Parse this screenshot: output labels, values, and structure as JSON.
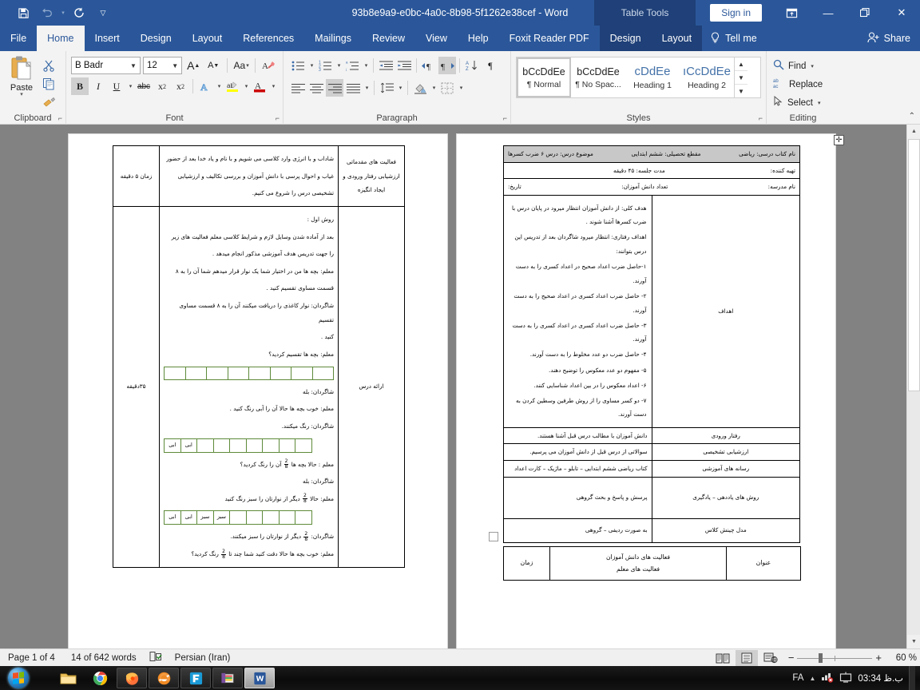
{
  "window": {
    "title": "93b8e9a9-e0bc-4a0c-8b98-5f1262e38cef  -  Word",
    "contextual_tool": "Table Tools",
    "signin_label": "Sign in",
    "minimize": "—",
    "restore": "❐",
    "close": "✕",
    "ribbon_display_options": "ribbon-display-icon"
  },
  "quick_access": {
    "save": "save-icon",
    "undo": "undo-icon",
    "redo": "redo-icon",
    "customize": "customize-icon"
  },
  "tabs": [
    {
      "label": "File",
      "active": false
    },
    {
      "label": "Home",
      "active": true
    },
    {
      "label": "Insert",
      "active": false
    },
    {
      "label": "Design",
      "active": false
    },
    {
      "label": "Layout",
      "active": false
    },
    {
      "label": "References",
      "active": false
    },
    {
      "label": "Mailings",
      "active": false
    },
    {
      "label": "Review",
      "active": false
    },
    {
      "label": "View",
      "active": false
    },
    {
      "label": "Help",
      "active": false
    },
    {
      "label": "Foxit Reader PDF",
      "active": false
    }
  ],
  "table_tools_tabs": [
    {
      "label": "Design"
    },
    {
      "label": "Layout"
    }
  ],
  "tell_me": "Tell me",
  "share": "Share",
  "ribbon": {
    "clipboard": {
      "group_label": "Clipboard",
      "paste_label": "Paste",
      "cut_label": "Cut",
      "copy_label": "Copy",
      "format_painter_label": "Format Painter"
    },
    "font": {
      "group_label": "Font",
      "font_name": "B Badr",
      "font_size": "12",
      "grow_font": "A",
      "shrink_font": "A",
      "change_case": "Aa",
      "clear_formatting": "clear-formatting-icon",
      "bold": "B",
      "italic": "I",
      "underline": "U",
      "strikethrough": "abc",
      "subscript": "x₂",
      "superscript": "x²",
      "text_effects": "A",
      "text_highlight": "ab",
      "font_color": "A"
    },
    "paragraph": {
      "group_label": "Paragraph",
      "bullets": "bullets-icon",
      "numbering": "numbering-icon",
      "multilevel": "multilevel-list-icon",
      "decrease_indent": "decrease-indent-icon",
      "increase_indent": "increase-indent-icon",
      "ltr": "left-to-right-icon",
      "rtl": "right-to-left-icon",
      "sort": "sort-icon",
      "show_marks": "¶",
      "align_left": "align-left-icon",
      "align_center": "align-center-icon",
      "align_right": "align-right-icon",
      "justify": "justify-icon",
      "line_spacing": "line-spacing-icon",
      "shading": "shading-icon",
      "borders": "borders-icon"
    },
    "styles": {
      "group_label": "Styles",
      "items": [
        {
          "sample": "bCcDdEe",
          "name": "¶ Normal",
          "selected": true
        },
        {
          "sample": "bCcDdEe",
          "name": "¶ No Spac...",
          "selected": false
        },
        {
          "sample": "cDdEe",
          "name": "Heading 1",
          "selected": false
        },
        {
          "sample": "ıCcDdEe",
          "name": "Heading 2",
          "selected": false
        }
      ]
    },
    "editing": {
      "group_label": "Editing",
      "find": "Find",
      "replace": "Replace",
      "select": "Select"
    }
  },
  "document": {
    "right_page": {
      "header_table": {
        "row1": {
          "subject": "موضوع درس: درس ۶ ضرب کسرها",
          "grade": "مقطع تحصیلی: ششم ابتدایی",
          "book": "نام کتاب درسی: ریاضی"
        },
        "row2": {
          "duration": "مدت جلسه: ۴۵ دقیقه",
          "author": "تهیه کننده:"
        },
        "row3": {
          "date": "تاریخ:",
          "students": "تعداد دانش آموزان:",
          "school": "نام مدرسه:"
        }
      },
      "rows": [
        {
          "label": "اهداف",
          "lines": [
            "هدف کلی: از دانش آموزان انتظار میرود در پایان درس با ضرب کسرها آشنا شوند .",
            "اهداف رفتاری: انتظار میرود شاگردان بعد از تدریس این درس بتوانند:",
            "۱-حاصل ضرب اعداد صحیح در اعداد کسری را به دست آورند.",
            "۲- حاصل ضرب اعداد کسری در اعداد صحیح را به دست آورند.",
            "۳- حاصل ضرب اعداد کسری در اعداد کسری را به دست آورند.",
            "۴- حاصل ضرب دو عدد مخلوط را به دست آورند.",
            "۵- مفهوم دو عدد معکوس را توضیح دهند.",
            "۶- اعداد معکوس را در بین اعداد شناسایی کنند.",
            "۷- دو کسر مساوی را از روش طرفین وسطین کردن به دست آورند."
          ]
        },
        {
          "label": "رفتار ورودی",
          "lines": [
            "دانش آموزان با مطالب درس قبل آشنا هستند."
          ]
        },
        {
          "label": "ارزشیابی تشخیصی",
          "lines": [
            "سوالاتی از درس قبل از دانش آموزان می پرسیم."
          ]
        },
        {
          "label": "رسانه های آموزشی",
          "lines": [
            "کتاب ریاضی ششم ابتدایی – تابلو – ماژیک – کارت اعداد"
          ]
        },
        {
          "label": "روش های یاددهی – یادگیری",
          "lines": [
            "پرسش و پاسخ و بحث گروهی"
          ]
        },
        {
          "label": "مدل چینش کلاس",
          "lines": [
            "به صورت ردیفی – گروهی"
          ]
        }
      ],
      "bottom_table": {
        "time": "زمان",
        "activities_line1": "فعالیت های دانش آموزان",
        "activities_line2": "فعالیت های معلم",
        "title": "عنوان"
      }
    },
    "left_page": {
      "row1": {
        "time": "زمان ۵ دقیقه",
        "title": "فعالیت های مقدماتی ارزشیابی رفتار ورودی و ایجاد انگیزه",
        "body": [
          "شاداب و با انرژی وارد کلاسی می شویم و با نام و یاد خدا بعد از حضور",
          "غیاب و احوال پرسی با دانش آموزان و بررسی تکالیف و ارزشیابی",
          "تشخیصی درس را شروع می کنیم."
        ]
      },
      "row2": {
        "time": "۳۵دقیقه",
        "title": "ارائه درس",
        "body": [
          "روش اول :",
          "بعد از آماده شدن وسایل لازم و شرایط کلاسی معلم فعالیت های زیر",
          "را جهت تدریس هدف آموزشی مذکور انجام میدهد .",
          "معلم: بچه ها من در اختیار شما یک نوار قرار میدهم شما آن را به ۸",
          "قسمت مساوی تقسیم کنید .",
          "شاگردان: نوار کاغذی را دریافت میکنند آن را به ۸ قسمت مساوی تقسیم",
          "کنید .",
          "معلم: بچه ها تقسیم کردید؟"
        ],
        "after_strip1": [
          "شاگردان: بله",
          "معلم: خوب بچه ها حالا آن را آبی رنگ کنید .",
          "شاگردان: رنگ میکنند."
        ],
        "after_strip2_pre": "معلم : حالا بچه ها",
        "after_strip2_post": "آن را رنگ کردید؟",
        "after_strip2_line2": "شاگردان: بله",
        "before_strip3_pre": "معلم: حالا",
        "before_strip3_post": "دیگر از نوارتان را سبز رنگ کنید",
        "after_strip3_pre": "شاگردان:",
        "after_strip3_post": "دیگر از نوارتان را سبز میکنند.",
        "last_pre": "معلم: خوب بچه ها حالا دقت کنید شما چند تا",
        "last_post": "رنگ کردید؟",
        "fraction": {
          "numerator": "2",
          "denominator": "8"
        },
        "strip1_cells": [
          "",
          "",
          "",
          "",
          "",
          "",
          "",
          ""
        ],
        "strip2_cells": [
          "ابی",
          "ابی",
          "",
          "",
          "",
          "",
          "",
          "",
          ""
        ],
        "strip3_cells": [
          "ابی",
          "ابی",
          "سبز",
          "سبز",
          "",
          "",
          "",
          "",
          ""
        ]
      }
    }
  },
  "status_bar": {
    "page": "Page 1 of 4",
    "words": "14 of 642 words",
    "proofing": "proofing-icon",
    "language": "Persian (Iran)",
    "read_mode": "read-mode-icon",
    "print_layout": "print-layout-icon",
    "web_layout": "web-layout-icon",
    "zoom_out": "−",
    "zoom_in": "+",
    "zoom_value": "60 %"
  },
  "taskbar": {
    "start": "start-orb-icon",
    "items": [
      {
        "name": "file-explorer-icon"
      },
      {
        "name": "chrome-icon"
      },
      {
        "name": "firefox-icon"
      },
      {
        "name": "internet-explorer-icon"
      },
      {
        "name": "foxit-reader-icon"
      },
      {
        "name": "winrar-icon"
      },
      {
        "name": "word-icon"
      }
    ],
    "language": "FA",
    "show_hidden": "▲",
    "network": "network-icon",
    "display": "display-icon",
    "clock": "ب.ظ 03:34"
  },
  "colors": {
    "word_blue": "#2b579a",
    "contextual_dark": "#1f4078",
    "ribbon_bg": "#f3f3f3",
    "table_border_green": "#5e8a3a",
    "header_gray": "#c8c8c8"
  }
}
